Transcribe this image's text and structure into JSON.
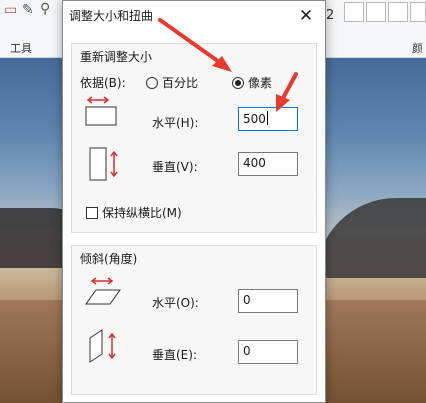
{
  "paint": {
    "ribbon_left_label": "工具",
    "ribbon_right_label": "颜",
    "tool_icons": [
      "eraser-icon",
      "color-picker-icon",
      "magnifier-icon"
    ],
    "ribbon_digit": "2"
  },
  "dialog": {
    "title": "调整大小和扭曲",
    "close_glyph": "✕",
    "resize": {
      "group_title": "重新调整大小",
      "by_label": "依据(B):",
      "option_percent": "百分比",
      "option_pixels": "像素",
      "selected_option": "pixels",
      "horizontal_label": "水平(H):",
      "horizontal_value": "500",
      "vertical_label": "垂直(V):",
      "vertical_value": "400",
      "keep_ratio_label": "保持纵横比(M)",
      "keep_ratio_checked": false
    },
    "skew": {
      "group_title": "倾斜(角度)",
      "horizontal_label": "水平(O):",
      "horizontal_value": "0",
      "vertical_label": "垂直(E):",
      "vertical_value": "0"
    }
  },
  "colors": {
    "annotation_arrow": "#e8392e",
    "icon_red": "#d32f2f",
    "focus_blue": "#0078d7"
  }
}
